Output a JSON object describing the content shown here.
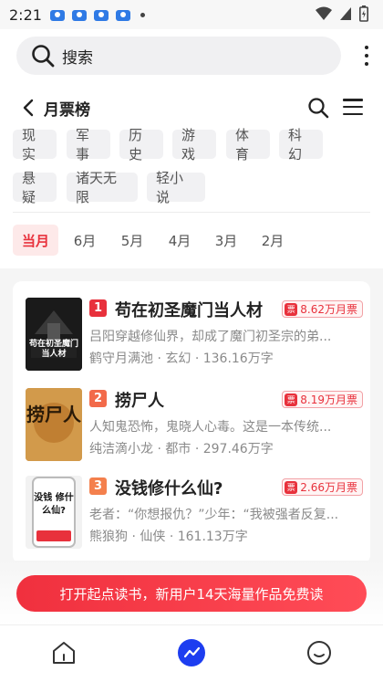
{
  "status_bar": {
    "time": "2:21"
  },
  "search": {
    "placeholder_label": "搜索"
  },
  "nav": {
    "title": "月票榜"
  },
  "categories": [
    "现实",
    "军事",
    "历史",
    "游戏",
    "体育",
    "科幻",
    "悬疑",
    "诸天无限",
    "轻小说"
  ],
  "months": [
    "当月",
    "6月",
    "5月",
    "4月",
    "3月",
    "2月"
  ],
  "books": [
    {
      "rank": "1",
      "title": "苟在初圣魔门当人材",
      "tickets": "8.62万月票",
      "desc": "吕阳穿越修仙界，却成了魔门初圣宗的弟...",
      "author": "鹤守月满池",
      "genre": "玄幻",
      "words": "136.16万字",
      "cover_text": "苟在初圣魔门 当人材"
    },
    {
      "rank": "2",
      "title": "捞尸人",
      "tickets": "8.19万月票",
      "desc": "人知鬼恐怖，鬼晓人心毒。这是一本传统...",
      "author": "纯洁滴小龙",
      "genre": "都市",
      "words": "297.46万字",
      "cover_text": "捞尸人"
    },
    {
      "rank": "3",
      "title": "没钱修什么仙?",
      "tickets": "2.66万月票",
      "desc": "老者：“你想报仇？”少年：“我被强者反复...",
      "author": "熊狼狗",
      "genre": "仙侠",
      "words": "161.13万字",
      "cover_text": "没钱 修什么仙?"
    }
  ],
  "meta_separator": "·",
  "promo": {
    "label": "打开起点读书，新用户14天海量作品免费读"
  },
  "colors": {
    "accent": "#e8313c",
    "rank_tab": "#1d3df0"
  }
}
